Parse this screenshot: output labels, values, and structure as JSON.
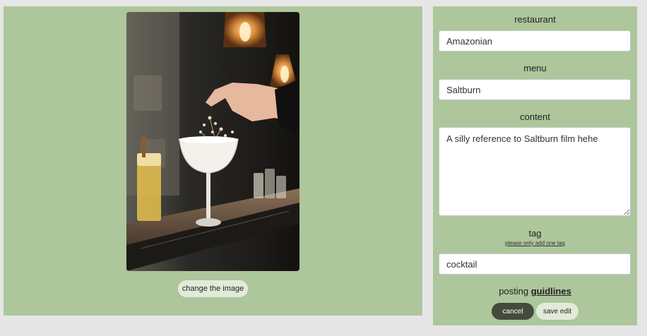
{
  "image": {
    "alt": "",
    "change_label": "change the image"
  },
  "form": {
    "restaurant": {
      "label": "restaurant",
      "value": "Amazonian"
    },
    "menu": {
      "label": "menu",
      "value": "Saltburn"
    },
    "content": {
      "label": "content",
      "value": "A silly reference to Saltburn film hehe"
    },
    "tag": {
      "label": "tag",
      "hint": "please only add one tag",
      "value": "cocktail"
    },
    "posting_text": "posting",
    "guidelines_link": "guidlines",
    "cancel_label": "cancel",
    "save_label": "save edit"
  },
  "colors": {
    "panel_bg": "#adc69b",
    "page_bg": "#e6e6e6",
    "primary_button": "#434b3d",
    "secondary_button": "#e2ebd9"
  }
}
